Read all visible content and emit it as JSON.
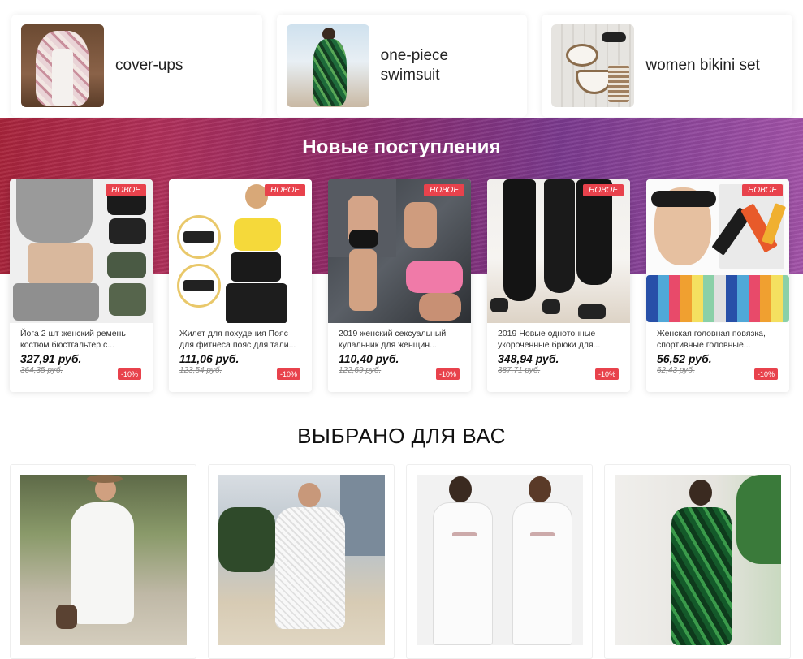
{
  "categories": [
    {
      "label": "cover-ups",
      "image": "cover-ups-photo"
    },
    {
      "label": "one-piece swimsuit",
      "image": "one-piece-swimsuit-photo"
    },
    {
      "label": "women bikini set",
      "image": "bikini-set-photo"
    }
  ],
  "banner": {
    "title": "Новые поступления"
  },
  "products": [
    {
      "badge": "НОВОЕ",
      "description": "Йога 2 шт женский ремень костюм бюстгальтер с...",
      "price": "327,91 руб.",
      "old_price": "364,35 руб.",
      "discount": "-10%"
    },
    {
      "badge": "НОВОЕ",
      "description": "Жилет для похудения Пояс для фитнеса пояс для тали...",
      "price": "111,06 руб.",
      "old_price": "123,54 руб.",
      "discount": "-10%"
    },
    {
      "badge": "НОВОЕ",
      "description": "2019 женский сексуальный купальник для женщин...",
      "price": "110,40 руб.",
      "old_price": "122,69 руб.",
      "discount": "-10%"
    },
    {
      "badge": "НОВОЕ",
      "description": "2019 Новые однотонные укороченные брюки для...",
      "price": "348,94 руб.",
      "old_price": "387,71 руб.",
      "discount": "-10%"
    },
    {
      "badge": "НОВОЕ",
      "description": "Женская головная повязка, спортивные головные...",
      "price": "56,52 руб.",
      "old_price": "62,43 руб.",
      "discount": "-10%"
    }
  ],
  "picks_section": {
    "title": "ВЫБРАНО ДЛЯ ВАС"
  },
  "picks": [
    {
      "image": "white-lace-dress-photo"
    },
    {
      "image": "white-crochet-coverup-photo"
    },
    {
      "image": "white-long-coverup-photo"
    },
    {
      "image": "green-leaf-swimsuit-photo"
    }
  ],
  "colors": {
    "accent_red": "#e8424c",
    "banner_left": "#a8243b",
    "banner_right": "#a253a8"
  }
}
